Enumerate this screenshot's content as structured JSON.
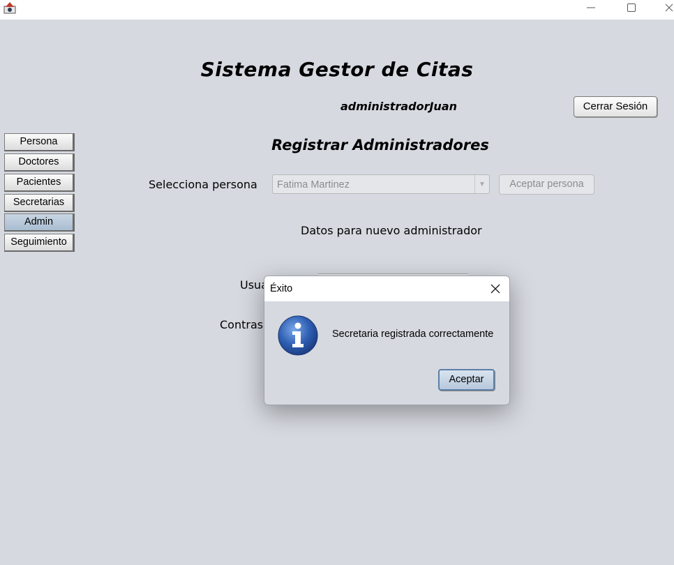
{
  "window": {
    "app_icon": "java-duke-icon",
    "minimize_icon": "minimize-icon",
    "maximize_icon": "maximize-icon",
    "close_icon": "close-icon"
  },
  "header": {
    "app_title": "Sistema Gestor de Citas",
    "username": "administradorJuan",
    "logout_label": "Cerrar Sesión"
  },
  "sidebar": {
    "items": [
      {
        "label": "Persona",
        "active": false
      },
      {
        "label": "Doctores",
        "active": false
      },
      {
        "label": "Pacientes",
        "active": false
      },
      {
        "label": "Secretarias",
        "active": false
      },
      {
        "label": "Admin",
        "active": true
      },
      {
        "label": "Seguimiento",
        "active": false
      }
    ]
  },
  "main": {
    "section_title": "Registrar Administradores",
    "select_person_label": "Selecciona persona",
    "select_person_value": "Fatima Martinez",
    "accept_person_label": "Aceptar persona",
    "new_admin_heading": "Datos para nuevo administrador",
    "user_label_partial": "Usua",
    "password_label_partial": "Contras"
  },
  "dialog": {
    "title": "Éxito",
    "message": "Secretaria registrada correctamente",
    "ok_label": "Aceptar",
    "icon": "info-icon",
    "accent_color": "#2f5fb3"
  }
}
